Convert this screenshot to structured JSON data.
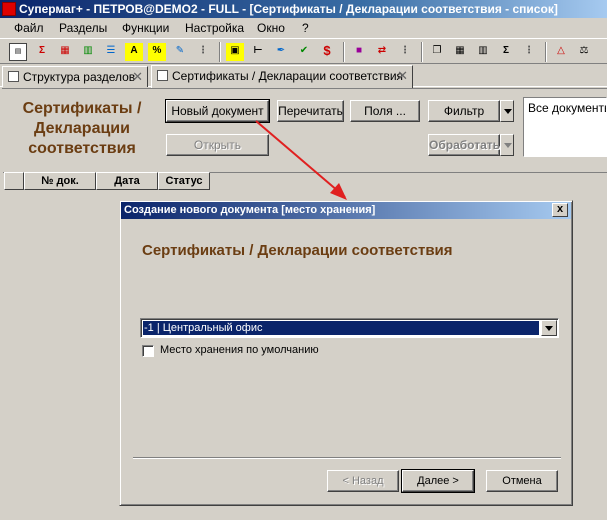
{
  "window": {
    "title": "Супермаг+ - ПЕТРОВ@DEMO2 - FULL - [Сертификаты / Декларации соответствия - список]"
  },
  "menu": {
    "items": [
      "Файл",
      "Разделы",
      "Функции",
      "Настройка",
      "Окно",
      "?"
    ]
  },
  "toolbar": {
    "icons": [
      "row-icon",
      "sigma-icon",
      "grid-icon",
      "sheet-icon",
      "text-icon",
      "font-a-icon",
      "percent-icon",
      "pencil-icon",
      "tree-icon",
      "calc-icon",
      "ruler-icon",
      "pen-icon",
      "check-icon",
      "dollar-icon",
      "truck-icon",
      "route-icon",
      "tree2-icon",
      "copy-icon",
      "table-icon",
      "bars-icon",
      "sum-icon",
      "warning-icon",
      "scale-icon"
    ]
  },
  "tabs": [
    {
      "label": "Структура разделов"
    },
    {
      "label": "Сертификаты / Декларации соответствия"
    }
  ],
  "doc_panel": {
    "heading_line1": "Сертификаты /",
    "heading_line2": "Декларации",
    "heading_line3": "соответствия",
    "new_doc_label": "Новый документ",
    "reread_label": "Перечитать",
    "fields_label": "Поля ...",
    "filter_label": "Фильтр",
    "open_label": "Открыть",
    "process_label": "Обработать",
    "all_docs_text": "Все документы"
  },
  "list": {
    "columns": [
      "№ док.",
      "Дата",
      "Статус"
    ]
  },
  "dialog": {
    "title": "Создание нового документа [место хранения]",
    "close_label": "x",
    "heading": "Сертификаты / Декларации соответствия",
    "location_value": "-1 | Центральный офис",
    "default_checkbox_label": "Место хранения по умолчанию",
    "back_label": "< Назад",
    "next_label": "Далее >",
    "cancel_label": "Отмена"
  },
  "colors": {
    "heading": "#6b3d12",
    "title_bar": "#0a246a",
    "arrow": "#e02020"
  }
}
